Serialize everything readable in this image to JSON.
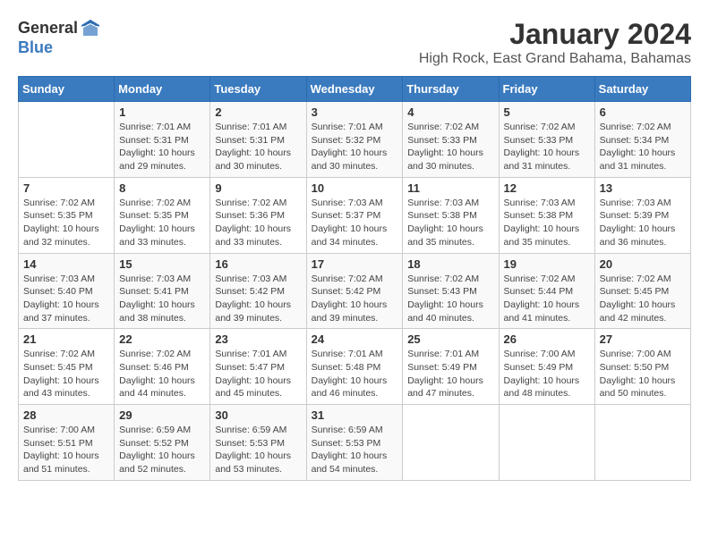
{
  "header": {
    "logo_general": "General",
    "logo_blue": "Blue",
    "month_year": "January 2024",
    "location": "High Rock, East Grand Bahama, Bahamas"
  },
  "days_of_week": [
    "Sunday",
    "Monday",
    "Tuesday",
    "Wednesday",
    "Thursday",
    "Friday",
    "Saturday"
  ],
  "weeks": [
    [
      {
        "day": "",
        "info": ""
      },
      {
        "day": "1",
        "info": "Sunrise: 7:01 AM\nSunset: 5:31 PM\nDaylight: 10 hours\nand 29 minutes."
      },
      {
        "day": "2",
        "info": "Sunrise: 7:01 AM\nSunset: 5:31 PM\nDaylight: 10 hours\nand 30 minutes."
      },
      {
        "day": "3",
        "info": "Sunrise: 7:01 AM\nSunset: 5:32 PM\nDaylight: 10 hours\nand 30 minutes."
      },
      {
        "day": "4",
        "info": "Sunrise: 7:02 AM\nSunset: 5:33 PM\nDaylight: 10 hours\nand 30 minutes."
      },
      {
        "day": "5",
        "info": "Sunrise: 7:02 AM\nSunset: 5:33 PM\nDaylight: 10 hours\nand 31 minutes."
      },
      {
        "day": "6",
        "info": "Sunrise: 7:02 AM\nSunset: 5:34 PM\nDaylight: 10 hours\nand 31 minutes."
      }
    ],
    [
      {
        "day": "7",
        "info": "Sunrise: 7:02 AM\nSunset: 5:35 PM\nDaylight: 10 hours\nand 32 minutes."
      },
      {
        "day": "8",
        "info": "Sunrise: 7:02 AM\nSunset: 5:35 PM\nDaylight: 10 hours\nand 33 minutes."
      },
      {
        "day": "9",
        "info": "Sunrise: 7:02 AM\nSunset: 5:36 PM\nDaylight: 10 hours\nand 33 minutes."
      },
      {
        "day": "10",
        "info": "Sunrise: 7:03 AM\nSunset: 5:37 PM\nDaylight: 10 hours\nand 34 minutes."
      },
      {
        "day": "11",
        "info": "Sunrise: 7:03 AM\nSunset: 5:38 PM\nDaylight: 10 hours\nand 35 minutes."
      },
      {
        "day": "12",
        "info": "Sunrise: 7:03 AM\nSunset: 5:38 PM\nDaylight: 10 hours\nand 35 minutes."
      },
      {
        "day": "13",
        "info": "Sunrise: 7:03 AM\nSunset: 5:39 PM\nDaylight: 10 hours\nand 36 minutes."
      }
    ],
    [
      {
        "day": "14",
        "info": "Sunrise: 7:03 AM\nSunset: 5:40 PM\nDaylight: 10 hours\nand 37 minutes."
      },
      {
        "day": "15",
        "info": "Sunrise: 7:03 AM\nSunset: 5:41 PM\nDaylight: 10 hours\nand 38 minutes."
      },
      {
        "day": "16",
        "info": "Sunrise: 7:03 AM\nSunset: 5:42 PM\nDaylight: 10 hours\nand 39 minutes."
      },
      {
        "day": "17",
        "info": "Sunrise: 7:02 AM\nSunset: 5:42 PM\nDaylight: 10 hours\nand 39 minutes."
      },
      {
        "day": "18",
        "info": "Sunrise: 7:02 AM\nSunset: 5:43 PM\nDaylight: 10 hours\nand 40 minutes."
      },
      {
        "day": "19",
        "info": "Sunrise: 7:02 AM\nSunset: 5:44 PM\nDaylight: 10 hours\nand 41 minutes."
      },
      {
        "day": "20",
        "info": "Sunrise: 7:02 AM\nSunset: 5:45 PM\nDaylight: 10 hours\nand 42 minutes."
      }
    ],
    [
      {
        "day": "21",
        "info": "Sunrise: 7:02 AM\nSunset: 5:45 PM\nDaylight: 10 hours\nand 43 minutes."
      },
      {
        "day": "22",
        "info": "Sunrise: 7:02 AM\nSunset: 5:46 PM\nDaylight: 10 hours\nand 44 minutes."
      },
      {
        "day": "23",
        "info": "Sunrise: 7:01 AM\nSunset: 5:47 PM\nDaylight: 10 hours\nand 45 minutes."
      },
      {
        "day": "24",
        "info": "Sunrise: 7:01 AM\nSunset: 5:48 PM\nDaylight: 10 hours\nand 46 minutes."
      },
      {
        "day": "25",
        "info": "Sunrise: 7:01 AM\nSunset: 5:49 PM\nDaylight: 10 hours\nand 47 minutes."
      },
      {
        "day": "26",
        "info": "Sunrise: 7:00 AM\nSunset: 5:49 PM\nDaylight: 10 hours\nand 48 minutes."
      },
      {
        "day": "27",
        "info": "Sunrise: 7:00 AM\nSunset: 5:50 PM\nDaylight: 10 hours\nand 50 minutes."
      }
    ],
    [
      {
        "day": "28",
        "info": "Sunrise: 7:00 AM\nSunset: 5:51 PM\nDaylight: 10 hours\nand 51 minutes."
      },
      {
        "day": "29",
        "info": "Sunrise: 6:59 AM\nSunset: 5:52 PM\nDaylight: 10 hours\nand 52 minutes."
      },
      {
        "day": "30",
        "info": "Sunrise: 6:59 AM\nSunset: 5:53 PM\nDaylight: 10 hours\nand 53 minutes."
      },
      {
        "day": "31",
        "info": "Sunrise: 6:59 AM\nSunset: 5:53 PM\nDaylight: 10 hours\nand 54 minutes."
      },
      {
        "day": "",
        "info": ""
      },
      {
        "day": "",
        "info": ""
      },
      {
        "day": "",
        "info": ""
      }
    ]
  ]
}
